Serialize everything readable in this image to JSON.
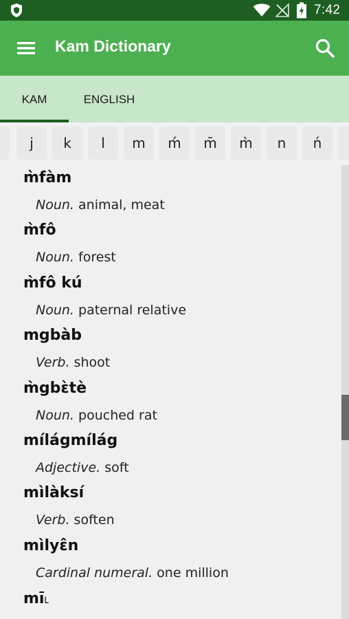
{
  "status_bar": {
    "time": "7:42"
  },
  "app_bar": {
    "title": "Kam Dictionary"
  },
  "tabs": [
    {
      "label": "KAM",
      "selected": true
    },
    {
      "label": "ENGLISH",
      "selected": false
    }
  ],
  "letters": [
    "",
    "j",
    "k",
    "l",
    "m",
    "ḿ",
    "m̄",
    "m̀",
    "n",
    "ń",
    ""
  ],
  "entries": [
    {
      "word": "m̀fàm",
      "pos": "Noun.",
      "meaning": "animal, meat"
    },
    {
      "word": "m̀fô",
      "pos": "Noun.",
      "meaning": "forest"
    },
    {
      "word": "m̀fô kú",
      "pos": "Noun.",
      "meaning": "paternal relative"
    },
    {
      "word": "mgbàb",
      "pos": "Verb.",
      "meaning": "shoot"
    },
    {
      "word": "m̀gbɛ̀tè",
      "pos": "Noun.",
      "meaning": "pouched rat"
    },
    {
      "word": "mílágmílág",
      "pos": "Adjective.",
      "meaning": "soft"
    },
    {
      "word": "mìlàksí",
      "pos": "Verb.",
      "meaning": "soften"
    },
    {
      "word": "mìlyɛ̂n",
      "pos": "Cardinal numeral.",
      "meaning": "one million"
    },
    {
      "word": "mī˪",
      "pos": "",
      "meaning": ""
    }
  ],
  "colors": {
    "status_bar": "#1e5e22",
    "app_bar": "#4caf50",
    "tab_bar": "#c8e6c9",
    "tab_indicator": "#1b5e20"
  }
}
